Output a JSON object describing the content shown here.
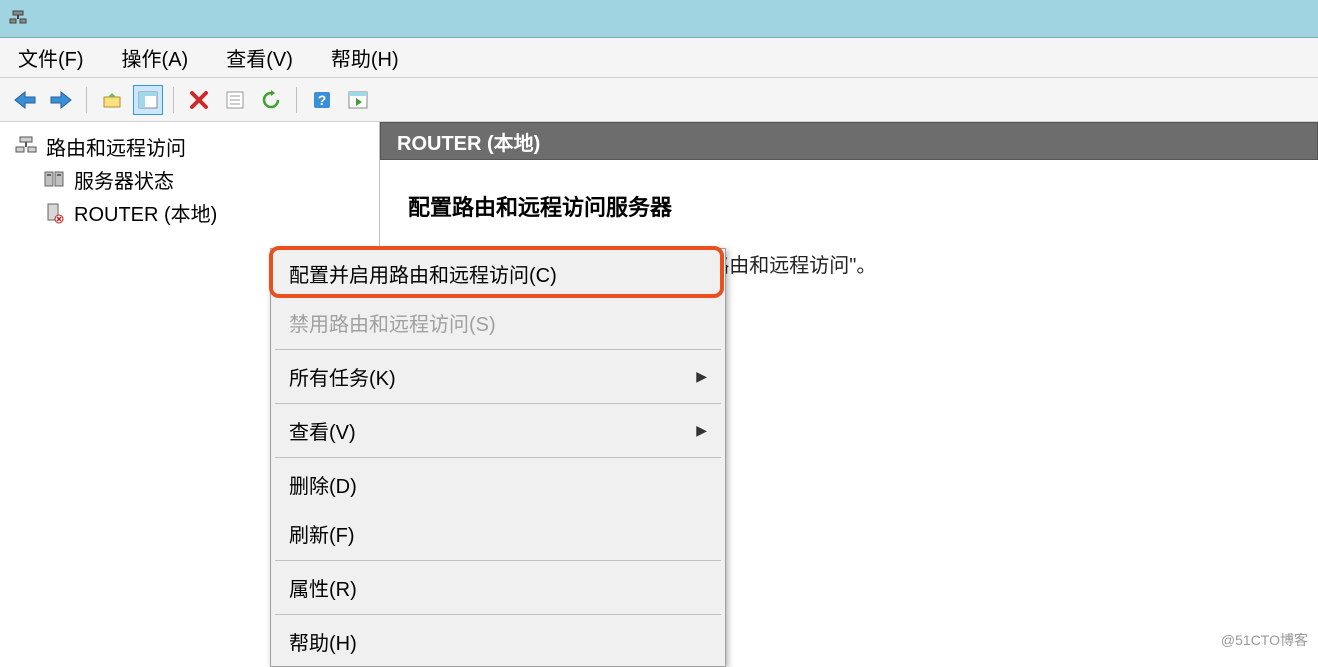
{
  "menubar": {
    "file": "文件(F)",
    "action": "操作(A)",
    "view": "查看(V)",
    "help": "帮助(H)"
  },
  "tree": {
    "root": "路由和远程访问",
    "status": "服务器状态",
    "router": "ROUTER (本地)"
  },
  "main": {
    "header": "ROUTER (本地)",
    "title": "配置路由和远程访问服务器",
    "text_visible": "请在\"操作\"菜单上单击\"配置并启用路由和远程访问\"。"
  },
  "context_menu": {
    "configure": "配置并启用路由和远程访问(C)",
    "disable": "禁用路由和远程访问(S)",
    "all_tasks": "所有任务(K)",
    "view": "查看(V)",
    "delete": "删除(D)",
    "refresh": "刷新(F)",
    "properties": "属性(R)",
    "help": "帮助(H)"
  },
  "watermark": "@51CTO博客"
}
